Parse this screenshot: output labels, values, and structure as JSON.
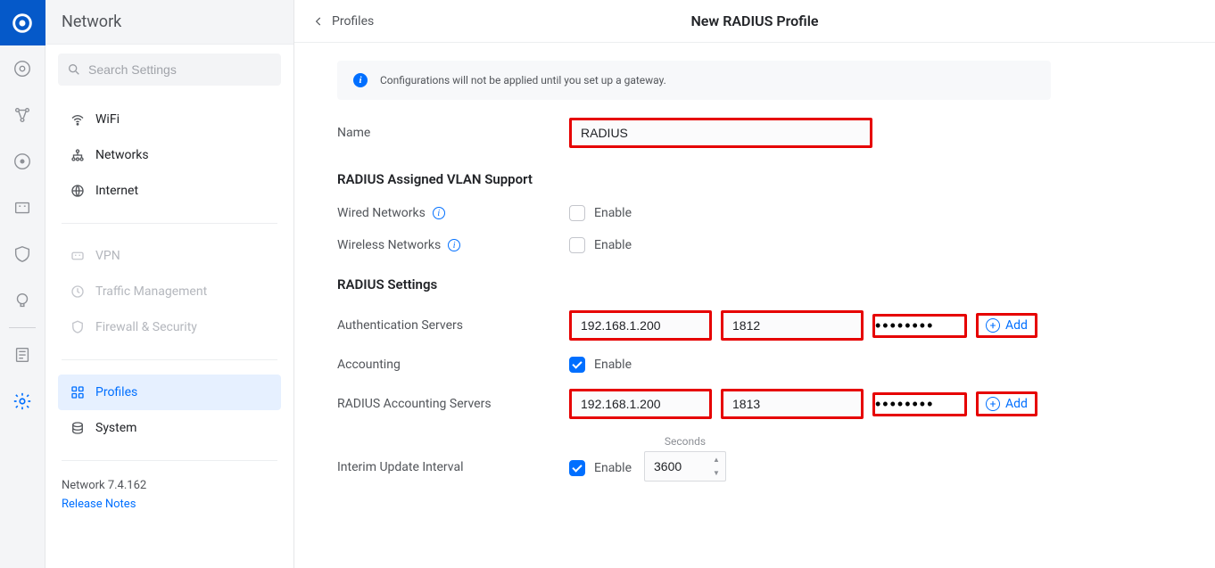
{
  "app": {
    "title": "Network",
    "search_placeholder": "Search Settings",
    "version": "Network 7.4.162",
    "release_notes": "Release Notes"
  },
  "sidebar": {
    "groups": [
      {
        "items": [
          {
            "label": "WiFi",
            "icon": "wifi",
            "enabled": true
          },
          {
            "label": "Networks",
            "icon": "networks",
            "enabled": true
          },
          {
            "label": "Internet",
            "icon": "globe",
            "enabled": true
          }
        ]
      },
      {
        "items": [
          {
            "label": "VPN",
            "icon": "vpn",
            "enabled": false
          },
          {
            "label": "Traffic Management",
            "icon": "traffic",
            "enabled": false
          },
          {
            "label": "Firewall & Security",
            "icon": "shield",
            "enabled": false
          }
        ]
      },
      {
        "items": [
          {
            "label": "Profiles",
            "icon": "profiles",
            "enabled": true,
            "active": true
          },
          {
            "label": "System",
            "icon": "system",
            "enabled": true
          }
        ]
      }
    ]
  },
  "page": {
    "back_label": "Profiles",
    "title": "New RADIUS Profile",
    "banner_text": "Configurations will not be applied until you set up a gateway."
  },
  "form": {
    "name_label": "Name",
    "name_value": "RADIUS",
    "vlan_section_title": "RADIUS Assigned VLAN Support",
    "wired_label": "Wired Networks",
    "wireless_label": "Wireless Networks",
    "enable_label": "Enable",
    "wired_checked": false,
    "wireless_checked": false,
    "settings_section_title": "RADIUS Settings",
    "auth_servers_label": "Authentication Servers",
    "accounting_label": "Accounting",
    "accounting_checked": true,
    "acct_servers_label": "RADIUS Accounting Servers",
    "add_label": "Add",
    "interim_label": "Interim Update Interval",
    "interim_checked": true,
    "seconds_label": "Seconds",
    "interim_value": "3600"
  },
  "servers": {
    "auth": {
      "ip": "192.168.1.200",
      "port": "1812",
      "password": "••••••••"
    },
    "acct": {
      "ip": "192.168.1.200",
      "port": "1813",
      "password": "••••••••"
    }
  }
}
